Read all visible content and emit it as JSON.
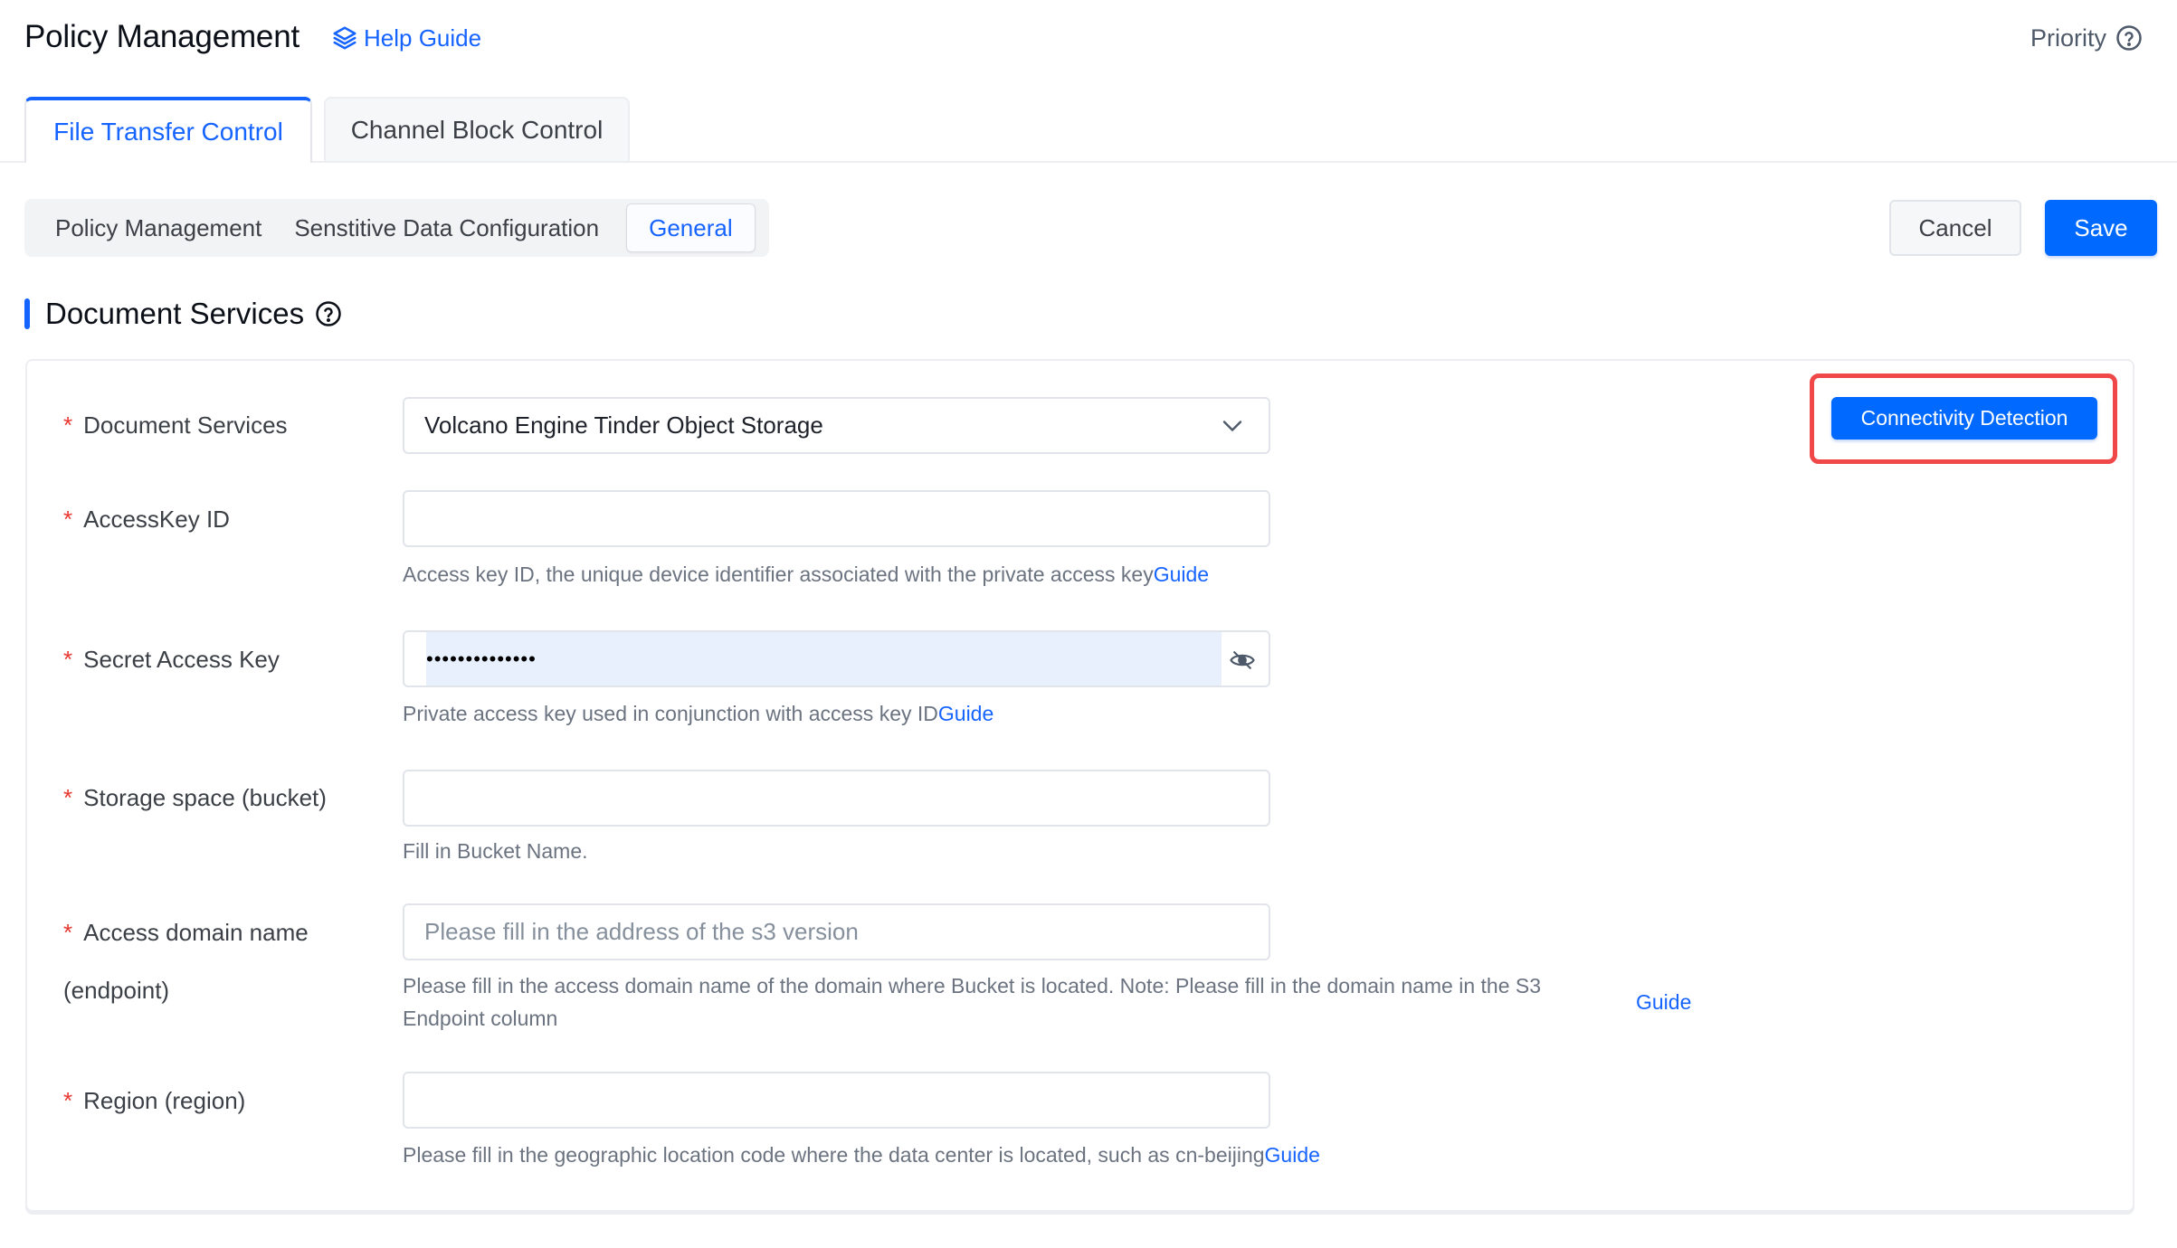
{
  "header": {
    "title": "Policy Management",
    "help_guide": "Help Guide",
    "priority": "Priority"
  },
  "tabs": [
    {
      "label": "File Transfer Control",
      "active": true
    },
    {
      "label": "Channel Block Control",
      "active": false
    }
  ],
  "subtabs": [
    {
      "label": "Policy Management",
      "active": false
    },
    {
      "label": "Senstitive Data Configuration",
      "active": false
    },
    {
      "label": "General",
      "active": true
    }
  ],
  "actions": {
    "cancel": "Cancel",
    "save": "Save"
  },
  "section": {
    "title": "Document Services"
  },
  "connectivity_button": "Connectivity Detection",
  "form": {
    "document_services": {
      "label": "Document Services",
      "value": "Volcano Engine Tinder Object Storage"
    },
    "access_key_id": {
      "label": "AccessKey ID",
      "value": "",
      "help": "Access key ID, the unique device identifier associated with the private access key",
      "guide": "Guide"
    },
    "secret_access_key": {
      "label": "Secret Access Key",
      "value_masked": "••••••••••••••",
      "help": "Private access key used in conjunction with access key ID",
      "guide": "Guide"
    },
    "bucket": {
      "label": "Storage space (bucket)",
      "value": "",
      "help": "Fill in Bucket Name."
    },
    "endpoint": {
      "label": "Access domain name",
      "label_line2": "(endpoint)",
      "placeholder": "Please fill in the address of the s3 version",
      "help_line1": "Please fill in the access domain name of the domain where Bucket is located. Note: Please fill in the domain name in the S3",
      "help_line2": "Endpoint column",
      "guide": "Guide"
    },
    "region": {
      "label": "Region (region)",
      "value": "",
      "help": "Please fill in the geographic location code where the data center is located, such as cn-beijing",
      "guide": "Guide"
    },
    "required_mark": "*"
  },
  "colors": {
    "primary": "#1664ff",
    "button_primary": "#0069ff",
    "required": "#e8352e",
    "highlight_box": "#f04848"
  }
}
